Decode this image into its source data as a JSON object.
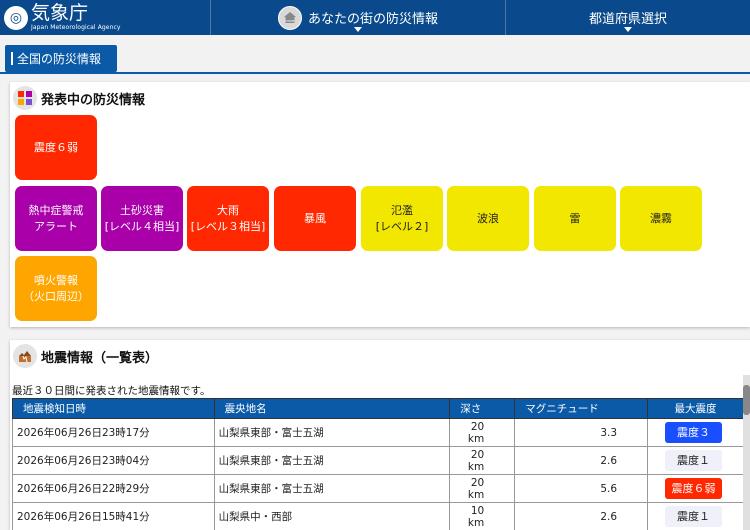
{
  "header": {
    "logo_text": "気象庁",
    "logo_en": "Japan Meteorological Agency",
    "home_badge": "HOME",
    "nav_local": "あなたの街の防災情報",
    "nav_prefecture": "都道府県選択"
  },
  "tab": {
    "label": "全国の防災情報"
  },
  "warnings": {
    "title": "発表中の防災情報",
    "items": [
      {
        "label": "震度６弱",
        "color": "#ff2800"
      },
      {
        "label": "熱中症警戒\nアラート",
        "color": "#aa00aa"
      },
      {
        "label": "土砂災害\n[レベル４相当]",
        "color": "#aa00aa"
      },
      {
        "label": "大雨\n[レベル３相当]",
        "color": "#ff2800"
      },
      {
        "label": "暴風",
        "color": "#ff2800"
      },
      {
        "label": "氾濫\n[レベル２]",
        "color": "#f2e700"
      },
      {
        "label": "波浪",
        "color": "#f2e700"
      },
      {
        "label": "雷",
        "color": "#f2e700"
      },
      {
        "label": "濃霧",
        "color": "#f2e700"
      },
      {
        "label": "噴火警報\n（火口周辺）",
        "color": "#ffa500"
      }
    ]
  },
  "quake": {
    "title": "地震情報（一覧表）",
    "note": "最近３０日間に発表された地震情報です。",
    "columns": [
      "地震検知日時",
      "震央地名",
      "深さ",
      "マグニチュード",
      "最大震度"
    ],
    "rows": [
      {
        "time": "2026年06月26日23時17分",
        "place": "山梨県東部・富士五湖",
        "depth": "20 km",
        "mag": "3.3",
        "max": "震度３",
        "max_bg": "#1a4fff",
        "max_fg": "#ffffff"
      },
      {
        "time": "2026年06月26日23時04分",
        "place": "山梨県東部・富士五湖",
        "depth": "20 km",
        "mag": "2.6",
        "max": "震度１",
        "max_bg": "#f0f0fa",
        "max_fg": "#222222"
      },
      {
        "time": "2026年06月26日22時29分",
        "place": "山梨県東部・富士五湖",
        "depth": "20 km",
        "mag": "5.6",
        "max": "震度６弱",
        "max_bg": "#ff2800",
        "max_fg": "#ffffff"
      },
      {
        "time": "2026年06月26日15時41分",
        "place": "山梨県中・西部",
        "depth": "10 km",
        "mag": "2.6",
        "max": "震度１",
        "max_bg": "#f0f0fa",
        "max_fg": "#222222"
      }
    ]
  },
  "colors": {
    "header": "#0a4a8c",
    "accent": "#0a5aa8"
  }
}
